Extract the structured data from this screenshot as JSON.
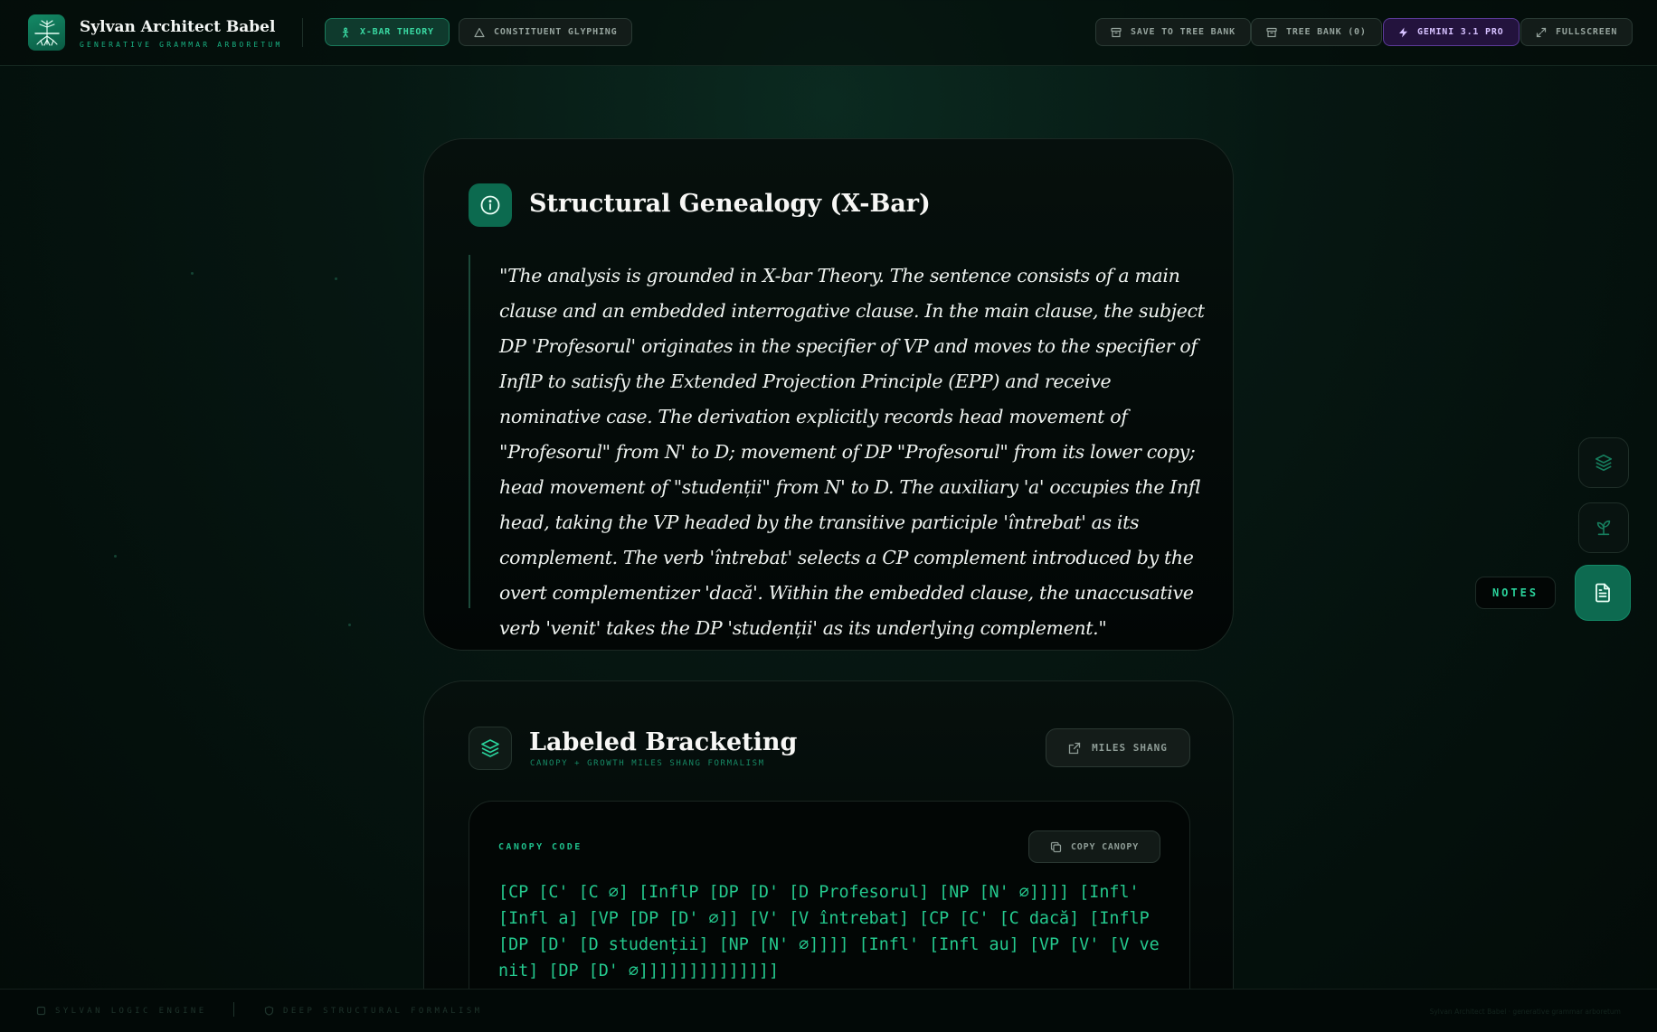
{
  "app": {
    "title": "Sylvan Architect Babel",
    "subtitle": "GENERATIVE GRAMMAR ARBORETUM"
  },
  "header": {
    "tabs": [
      {
        "label": "X-BAR THEORY",
        "active": true,
        "icon": "figure-icon"
      },
      {
        "label": "CONSTITUENT GLYPHING",
        "active": false,
        "icon": "triangle-icon"
      }
    ],
    "actions": {
      "save": "SAVE TO TREE BANK",
      "tree_bank": "TREE BANK (0)",
      "model": "GEMINI 3.1 PRO",
      "fullscreen": "FULLSCREEN"
    }
  },
  "genealogy": {
    "title": "Structural Genealogy (X-Bar)",
    "icon": "info-icon",
    "quote": "\"The analysis is grounded in X-bar Theory. The sentence consists of a main clause and an embedded interrogative clause. In the main clause, the subject DP 'Profesorul' originates in the specifier of VP and moves to the specifier of InflP to satisfy the Extended Projection Principle (EPP) and receive nominative case. The derivation explicitly records head movement of \"Profesorul\" from N' to D; movement of DP \"Profesorul\" from its lower copy; head movement of \"studenții\" from N' to D. The auxiliary 'a' occupies the Infl head, taking the VP headed by the transitive participle 'întrebat' as its complement. The verb 'întrebat' selects a CP complement introduced by the overt complementizer 'dacă'. Within the embedded clause, the unaccusative verb 'venit' takes the DP 'studenții' as its underlying complement.\""
  },
  "bracketing": {
    "title": "Labeled Bracketing",
    "subtitle": "CANOPY + GROWTH MILES SHANG FORMALISM",
    "icon": "layers-icon",
    "external_button": "MILES SHANG",
    "code_label": "CANOPY CODE",
    "copy_button": "COPY CANOPY",
    "code": "[CP [C' [C ∅] [InflP [DP [D' [D Profesorul] [NP [N' ∅]]]] [Infl' [Infl a] [VP [DP [D' ∅]] [V' [V întrebat] [CP [C' [C dacă] [InflP [DP [D' [D studenții] [NP [N' ∅]]]] [Infl' [Infl au] [VP [V' [V venit] [DP [D' ∅]]]]]]]]]]]]]]"
  },
  "side_rail": {
    "notes_label": "NOTES",
    "buttons": [
      "layers-icon",
      "sprout-icon",
      "document-icon"
    ],
    "active": "document-icon"
  },
  "footer": {
    "left": "SYLVAN LOGIC ENGINE",
    "middle": "DEEP STRUCTURAL FORMALISM",
    "right": "Sylvan Architect Babel · generative grammar arboretum"
  },
  "colors": {
    "accent": "#19b283",
    "accent_dark": "#0c6a4f",
    "code_text": "#24c98e",
    "gemini": "#d6c1ff"
  }
}
